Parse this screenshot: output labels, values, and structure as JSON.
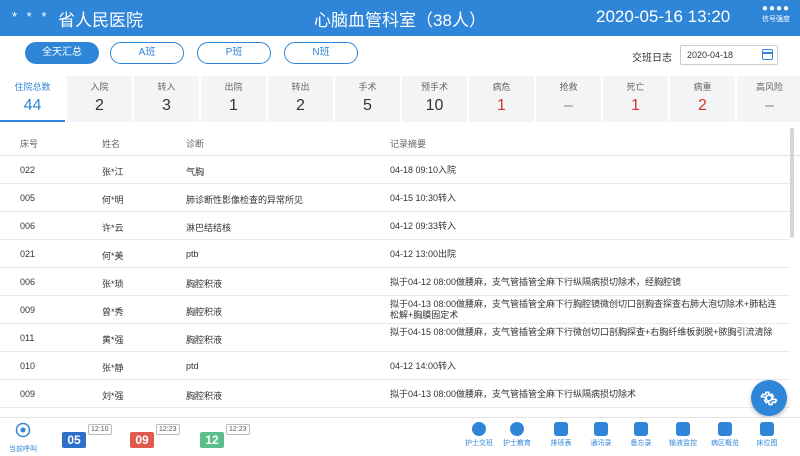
{
  "header": {
    "stars": "* * *",
    "hospital": "省人民医院",
    "department": "心脑血管科室（38人）",
    "datetime": "2020-05-16  13:20",
    "signal_label": "信号强度"
  },
  "shifts": {
    "tabs": [
      "全天汇总",
      "A班",
      "P班",
      "N班"
    ],
    "active_index": 0,
    "handover_label": "交班日志",
    "date_value": "2020-04-18"
  },
  "stats": [
    {
      "label": "住院总数",
      "value": "44"
    },
    {
      "label": "入院",
      "value": "2"
    },
    {
      "label": "转入",
      "value": "3"
    },
    {
      "label": "出院",
      "value": "1"
    },
    {
      "label": "转出",
      "value": "2"
    },
    {
      "label": "手术",
      "value": "5"
    },
    {
      "label": "预手术",
      "value": "10"
    },
    {
      "label": "病危",
      "value": "1"
    },
    {
      "label": "抢救",
      "value": "–"
    },
    {
      "label": "死亡",
      "value": "1"
    },
    {
      "label": "病重",
      "value": "2"
    },
    {
      "label": "高风险",
      "value": "–"
    }
  ],
  "stat_colors": {
    "active": "#2f86d8",
    "critical": "#d9342b"
  },
  "table": {
    "headers": [
      "床号",
      "姓名",
      "诊断",
      "记录摘要"
    ],
    "rows": [
      {
        "bed": "022",
        "name": "张*江",
        "diagnosis": "气胸",
        "summary": "04-18 09:10入院"
      },
      {
        "bed": "005",
        "name": "何*明",
        "diagnosis": "肺诊断性影像检查的异常所见",
        "summary": "04-15 10:30转入"
      },
      {
        "bed": "006",
        "name": "许*云",
        "diagnosis": "淋巴结结核",
        "summary": "04-12 09:33转入"
      },
      {
        "bed": "021",
        "name": "何*美",
        "diagnosis": "ptb",
        "summary": "04-12 13:00出院"
      },
      {
        "bed": "006",
        "name": "张*琐",
        "diagnosis": "胸腔积液",
        "summary": "拟于04-12 08:00做腰麻，支气管插管全麻下行纵隔病损切除术，经胸腔镜"
      },
      {
        "bed": "009",
        "name": "曾*秀",
        "diagnosis": "胸腔积液",
        "summary": "拟于04-13 08:00做腰麻，支气管插管全麻下行胸腔镜微创切口剖胸查探查右肺大泡切除术+肺粘连松解+胸膜固定术"
      },
      {
        "bed": "011",
        "name": "黄*强",
        "diagnosis": "胸腔积液",
        "summary": "拟于04-15 08:00做腰麻，支气管插管全麻下行微创切口剖胸探查+右胸纤维板剥脱+脓胸引流清除"
      },
      {
        "bed": "010",
        "name": "张*静",
        "diagnosis": "ptd",
        "summary": "04-12 14:00转入"
      },
      {
        "bed": "009",
        "name": "刘*强",
        "diagnosis": "胸腔积液",
        "summary": "拟于04-13 08:00做腰麻，支气管插管全麻下行纵隔病损切除术"
      }
    ]
  },
  "footer": {
    "current_call_label": "当前呼叫",
    "queue": [
      {
        "number": "05",
        "time": "12:10",
        "color": "#2f6fc8"
      },
      {
        "number": "09",
        "time": "12:23",
        "color": "#e05a4e"
      },
      {
        "number": "12",
        "time": "12:23",
        "color": "#5cbf8a"
      }
    ],
    "tools": [
      {
        "label": "护士交班",
        "icon": "nurse-icon"
      },
      {
        "label": "护士教育",
        "icon": "graduation-cap-icon"
      },
      {
        "label": "排班表",
        "icon": "schedule-icon"
      },
      {
        "label": "通讯录",
        "icon": "contacts-icon"
      },
      {
        "label": "备忘录",
        "icon": "memo-icon"
      },
      {
        "label": "输液监控",
        "icon": "infusion-monitor-icon"
      },
      {
        "label": "病区概览",
        "icon": "ward-overview-icon"
      },
      {
        "label": "床位图",
        "icon": "bed-map-icon"
      }
    ]
  }
}
